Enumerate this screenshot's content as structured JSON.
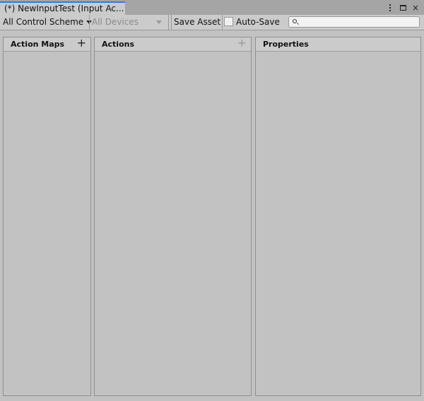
{
  "tab": {
    "title": "(*) NewInputTest (Input Ac..."
  },
  "window_buttons": {
    "menu": "kebab-menu-icon",
    "maximize": "maximize-icon",
    "close": "×"
  },
  "toolbar": {
    "control_scheme": "All Control Scheme",
    "devices": "All Devices",
    "save_asset": "Save Asset",
    "auto_save_label": "Auto-Save",
    "auto_save_checked": false,
    "search_value": "",
    "search_placeholder": ""
  },
  "panels": {
    "action_maps": {
      "title": "Action Maps",
      "add": "+"
    },
    "actions": {
      "title": "Actions",
      "add": "+"
    },
    "properties": {
      "title": "Properties"
    }
  }
}
